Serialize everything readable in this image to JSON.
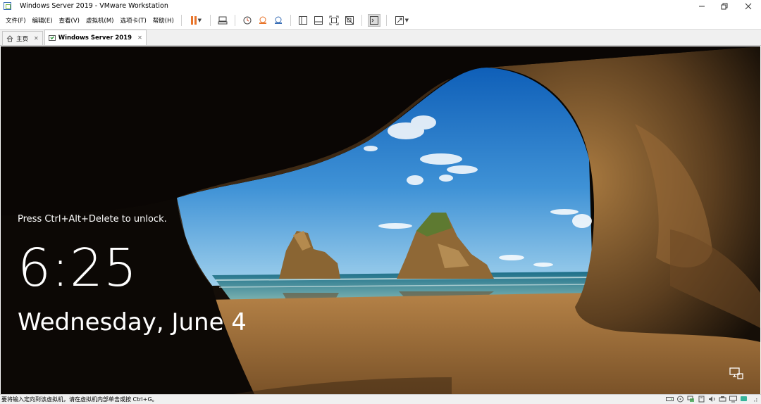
{
  "window": {
    "title": "Windows Server 2019 - VMware Workstation",
    "controls": [
      "minimize",
      "restore",
      "close"
    ]
  },
  "menu": {
    "items": [
      {
        "label": "文件(F)"
      },
      {
        "label": "编辑(E)"
      },
      {
        "label": "查看(V)"
      },
      {
        "label": "虚拟机(M)"
      },
      {
        "label": "选项卡(T)"
      },
      {
        "label": "帮助(H)"
      }
    ]
  },
  "toolbar": {
    "icons": [
      "pause-icon",
      "send-ctrl-alt-del-icon",
      "snapshot-icon",
      "revert-snapshot-icon",
      "snapshot-manager-icon",
      "library-view-icon",
      "thumbnail-view-icon",
      "fullscreen-icon",
      "unity-icon",
      "console-view-icon",
      "stretch-guest-icon"
    ],
    "accent": "#e8742a"
  },
  "tabs": [
    {
      "label": "主页",
      "icon": "home-icon",
      "active": false
    },
    {
      "label": "Windows Server 2019",
      "icon": "vm-icon",
      "active": true
    }
  ],
  "lockscreen": {
    "message": "Press Ctrl+Alt+Delete to unlock.",
    "time": "6:25",
    "date": "Wednesday, June 4"
  },
  "statusbar": {
    "text": "要将输入定向到该虚拟机，请在虚拟机内部单击或按 Ctrl+G。",
    "icons": [
      "hard-disk-icon",
      "cd-icon",
      "network-icon",
      "usb-icon",
      "sound-icon",
      "printer-icon",
      "display-icon",
      "message-icon",
      "resize-grip-icon"
    ]
  }
}
